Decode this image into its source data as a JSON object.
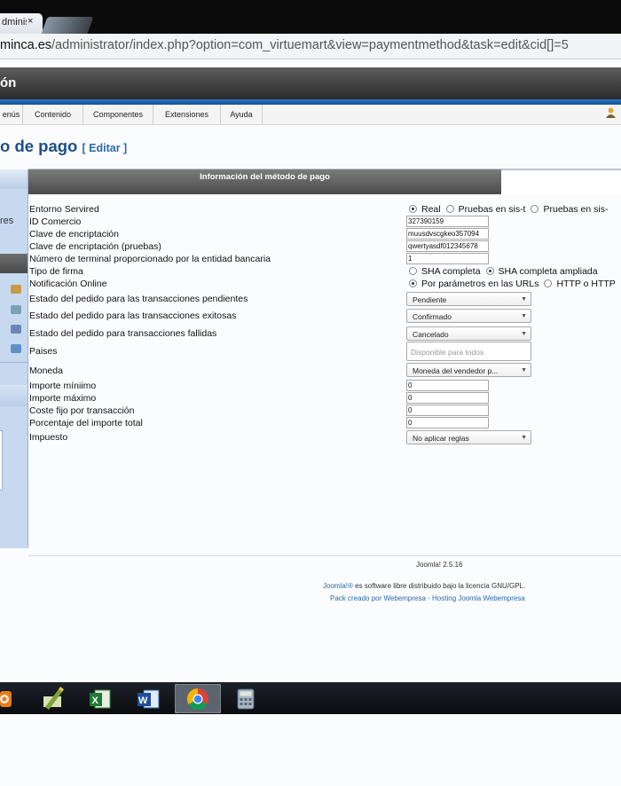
{
  "browser": {
    "tab_title": "dministr",
    "tab_close": "×",
    "url_host": "minca.es",
    "url_path": "/administrator/index.php?option=com_virtuemart&view=paymentmethod&task=edit&cid[]=5"
  },
  "admin": {
    "header_title": "ón",
    "menu": [
      "enús",
      "Contenido",
      "Componentes",
      "Extensiones",
      "Ayuda"
    ],
    "page_title": "o de pago",
    "page_subtitle": "[ Editar ]"
  },
  "sidebar": {
    "text": "res"
  },
  "panel": {
    "header": "Información del método de pago"
  },
  "form": {
    "entorno_label": "Entorno Servired",
    "entorno_options": [
      "Real",
      "Pruebas en sis-t",
      "Pruebas en sis-"
    ],
    "id_comercio_label": "ID Comercio",
    "id_comercio_value": "327390159",
    "clave_label": "Clave de encriptación",
    "clave_value": "muusdvscgkeo357094",
    "clave_pruebas_label": "Clave de encriptación (pruebas)",
    "clave_pruebas_value": "qwertyasdf012345678",
    "terminal_label": "Número de terminal proporcionado por la entidad bancaria",
    "terminal_value": "1",
    "tipo_firma_label": "Tipo de firma",
    "tipo_firma_options": [
      "SHA completa",
      "SHA completa ampliada"
    ],
    "notificacion_label": "Notificación Online",
    "notificacion_options": [
      "Por parámetros en las URLs",
      "HTTP o HTTP"
    ],
    "pendiente_label": "Estado del pedido para las transacciones pendientes",
    "pendiente_value": "Pendiente",
    "exitosas_label": "Estado del pedido para las transacciones exitosas",
    "exitosas_value": "Confirmado",
    "fallidas_label": "Estado del pedido para transacciones fallidas",
    "fallidas_value": "Cancelado",
    "paises_label": "Paises",
    "paises_placeholder": "Disponible para todos",
    "moneda_label": "Moneda",
    "moneda_value": "Moneda del vendedor p...",
    "importe_min_label": "Importe míniimo",
    "importe_min_value": "0",
    "importe_max_label": "Importe máximo",
    "importe_max_value": "0",
    "coste_label": "Coste fijo por transacción",
    "coste_value": "0",
    "porcentaje_label": "Porcentaje del importe total",
    "porcentaje_value": "0",
    "impuesto_label": "Impuesto",
    "impuesto_value": "No aplicar reglas"
  },
  "footer": {
    "version": "Joomla! 2.5.16",
    "license_link": "Joomla!®",
    "license_text": " es software libre distribuido bajo la licencia GNU/GPL.",
    "pack": "Pack creado por Webempresa - Hosting Joomla Webempresa"
  },
  "taskbar": {
    "apps": [
      "media-player",
      "pen-app",
      "excel-app",
      "word-app",
      "chrome-app",
      "calculator-app"
    ],
    "active": "chrome-app"
  }
}
